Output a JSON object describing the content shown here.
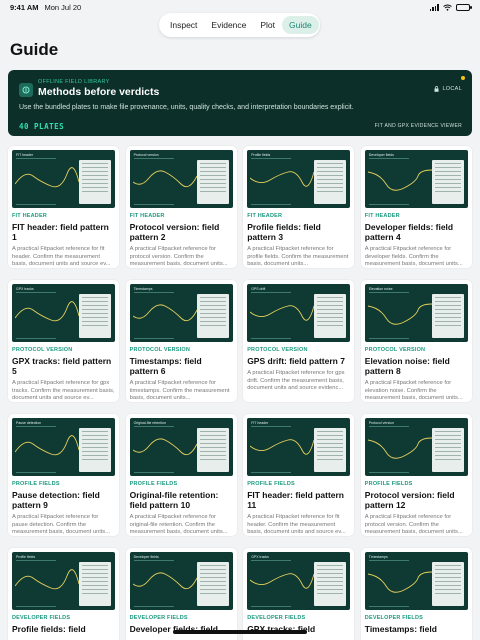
{
  "status": {
    "time": "9:41 AM",
    "date": "Mon Jul 20"
  },
  "nav": {
    "tabs": [
      "Inspect",
      "Evidence",
      "Plot",
      "Guide"
    ],
    "active": 3
  },
  "page": {
    "title": "Guide"
  },
  "hero": {
    "eyebrow": "OFFLINE FIELD LIBRARY",
    "title": "Methods before verdicts",
    "description": "Use the bundled plates to make file provenance, units, quality checks, and interpretation boundaries explicit.",
    "plates_label": "40 PLATES",
    "local_label": "LOCAL",
    "viewer_label": "FIT AND GPX EVIDENCE VIEWER",
    "accent": "#2fe0b0"
  },
  "cards": [
    {
      "plate": "FIT header",
      "category": "FIT HEADER",
      "title": "FIT header: field pattern 1",
      "desc": "A practical Fitpacket reference for fit header. Confirm the measurement basis, document units and source ev..."
    },
    {
      "plate": "Protocol version",
      "category": "FIT HEADER",
      "title": "Protocol version: field pattern 2",
      "desc": "A practical Fitpacket reference for protocol version. Confirm the measurement basis, document units..."
    },
    {
      "plate": "Profile fields",
      "category": "FIT HEADER",
      "title": "Profile fields: field pattern 3",
      "desc": "A practical Fitpacket reference for profile fields. Confirm the measurement basis, document units..."
    },
    {
      "plate": "Developer fields",
      "category": "FIT HEADER",
      "title": "Developer fields: field pattern 4",
      "desc": "A practical Fitpacket reference for developer fields. Confirm the measurement basis, document units..."
    },
    {
      "plate": "GPX tracks",
      "category": "PROTOCOL VERSION",
      "title": "GPX tracks: field pattern 5",
      "desc": "A practical Fitpacket reference for gpx tracks. Confirm the measurement basis, document units and source ev..."
    },
    {
      "plate": "Timestamps",
      "category": "PROTOCOL VERSION",
      "title": "Timestamps: field pattern 6",
      "desc": "A practical Fitpacket reference for timestamps. Confirm the measurement basis, document units..."
    },
    {
      "plate": "GPS drift",
      "category": "PROTOCOL VERSION",
      "title": "GPS drift: field pattern 7",
      "desc": "A practical Fitpacket reference for gps drift. Confirm the measurement basis, document units and source evidenc..."
    },
    {
      "plate": "Elevation noise",
      "category": "PROTOCOL VERSION",
      "title": "Elevation noise: field pattern 8",
      "desc": "A practical Fitpacket reference for elevation noise. Confirm the measurement basis, document units..."
    },
    {
      "plate": "Pause detection",
      "category": "PROFILE FIELDS",
      "title": "Pause detection: field pattern 9",
      "desc": "A practical Fitpacket reference for pause detection. Confirm the measurement basis, document units..."
    },
    {
      "plate": "Original-file retention",
      "category": "PROFILE FIELDS",
      "title": "Original-file retention: field pattern 10",
      "desc": "A practical Fitpacket reference for original-file retention. Confirm the measurement basis, document units..."
    },
    {
      "plate": "FIT header",
      "category": "PROFILE FIELDS",
      "title": "FIT header: field pattern 11",
      "desc": "A practical Fitpacket reference for fit header. Confirm the measurement basis, document units and source ev..."
    },
    {
      "plate": "Protocol version",
      "category": "PROFILE FIELDS",
      "title": "Protocol version: field pattern 12",
      "desc": "A practical Fitpacket reference for protocol version. Confirm the measurement basis, document units..."
    },
    {
      "plate": "Profile fields",
      "category": "DEVELOPER FIELDS",
      "title": "Profile fields: field",
      "desc": ""
    },
    {
      "plate": "Developer fields",
      "category": "DEVELOPER FIELDS",
      "title": "Developer fields: field",
      "desc": ""
    },
    {
      "plate": "GPX tracks",
      "category": "DEVELOPER FIELDS",
      "title": "GPX tracks: field",
      "desc": ""
    },
    {
      "plate": "Timestamps",
      "category": "DEVELOPER FIELDS",
      "title": "Timestamps: field",
      "desc": ""
    }
  ],
  "colors": {
    "accent": "#1b9a80",
    "hero_bg": "#0d2f29",
    "plate_bg": "#0f3a33",
    "nav_active": "#dcefe9"
  }
}
